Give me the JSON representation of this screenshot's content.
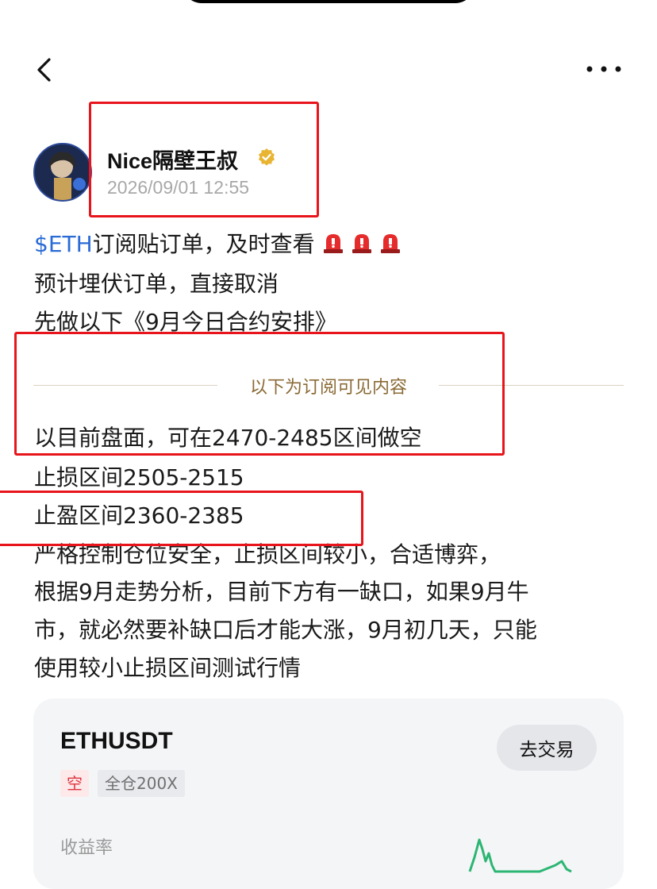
{
  "nav": {
    "back_icon": "chevron-left-icon",
    "more_icon": "more-dots-icon"
  },
  "author": {
    "name": "Nice隔壁王叔",
    "verified_icon": "verified-badge-icon",
    "date": "2026/09/01 12:55"
  },
  "post": {
    "tag": "$ETH",
    "line1_text": "订阅贴订单，及时查看",
    "line2": "预计埋伏订单，直接取消",
    "line3": "先做以下《9月今日合约安排》",
    "divider_label": "以下为订阅可见内容",
    "line4": "以目前盘面，可在2470-2485区间做空",
    "line5": "止损区间2505-2515",
    "line6": "止盈区间2360-2385",
    "line7": "严格控制仓位安全，止损区间较小，合适博弈，",
    "line8": "根据9月走势分析，目前下方有一缺口，如果9月牛",
    "line9": "市，就必然要补缺口后才能大涨，9月初几天，只能",
    "line10": "使用较小止损区间测试行情"
  },
  "trade_card": {
    "symbol": "ETHUSDT",
    "trade_button": "去交易",
    "side": "空",
    "margin_mode": "全仓200X",
    "yield_label": "收益率"
  },
  "colors": {
    "highlight": "#e8141b",
    "link": "#2a6bd6",
    "divider_text": "#8a6a35",
    "short": "#e0323c",
    "chart_green": "#2bb673"
  }
}
